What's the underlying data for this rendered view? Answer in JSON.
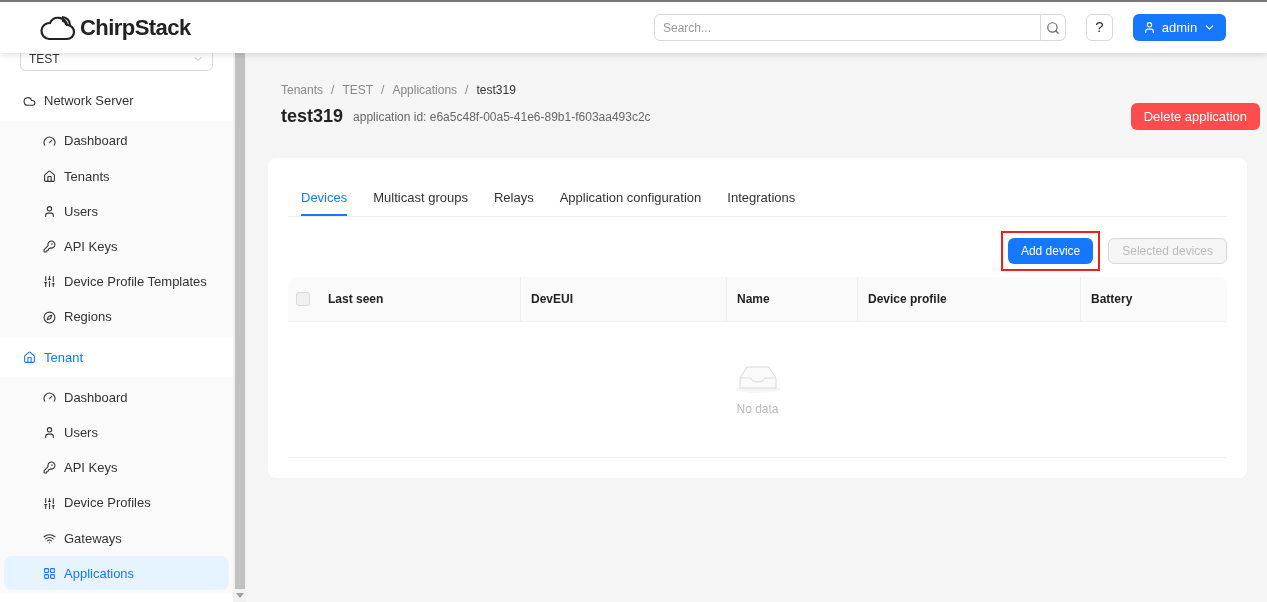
{
  "header": {
    "logo": "ChirpStack",
    "search": {
      "placeholder": "Search..."
    },
    "help": "?",
    "user": "admin"
  },
  "sidebar": {
    "tenant_select": "TEST",
    "menu": [
      {
        "label": "Network Server",
        "selected": false,
        "children": [
          {
            "label": "Dashboard",
            "selected": false
          },
          {
            "label": "Tenants",
            "selected": false
          },
          {
            "label": "Users",
            "selected": false
          },
          {
            "label": "API Keys",
            "selected": false
          },
          {
            "label": "Device Profile Templates",
            "selected": false
          },
          {
            "label": "Regions",
            "selected": false
          }
        ]
      },
      {
        "label": "Tenant",
        "selected": true,
        "children": [
          {
            "label": "Dashboard",
            "selected": false
          },
          {
            "label": "Users",
            "selected": false
          },
          {
            "label": "API Keys",
            "selected": false
          },
          {
            "label": "Device Profiles",
            "selected": false
          },
          {
            "label": "Gateways",
            "selected": false
          },
          {
            "label": "Applications",
            "selected": true
          }
        ]
      }
    ]
  },
  "breadcrumb": {
    "separator": "/",
    "items": [
      "Tenants",
      "TEST",
      "Applications",
      "test319"
    ]
  },
  "page": {
    "title": "test319",
    "subtitle": "application id: e6a5c48f-00a5-41e6-89b1-f603aa493c2c",
    "delete_button": "Delete application"
  },
  "tabs": [
    {
      "label": "Devices",
      "selected": true
    },
    {
      "label": "Multicast groups",
      "selected": false
    },
    {
      "label": "Relays",
      "selected": false
    },
    {
      "label": "Application configuration",
      "selected": false
    },
    {
      "label": "Integrations",
      "selected": false
    }
  ],
  "actions": [
    {
      "label": "Add device",
      "kind": "primary",
      "highlighted": true,
      "disabled": false
    },
    {
      "label": "Selected devices",
      "kind": "default",
      "highlighted": false,
      "disabled": true
    }
  ],
  "table": {
    "select_all": {
      "checked": false
    },
    "columns": [
      "Last seen",
      "DevEUI",
      "Name",
      "Device profile",
      "Battery"
    ],
    "empty_text": "No data"
  }
}
